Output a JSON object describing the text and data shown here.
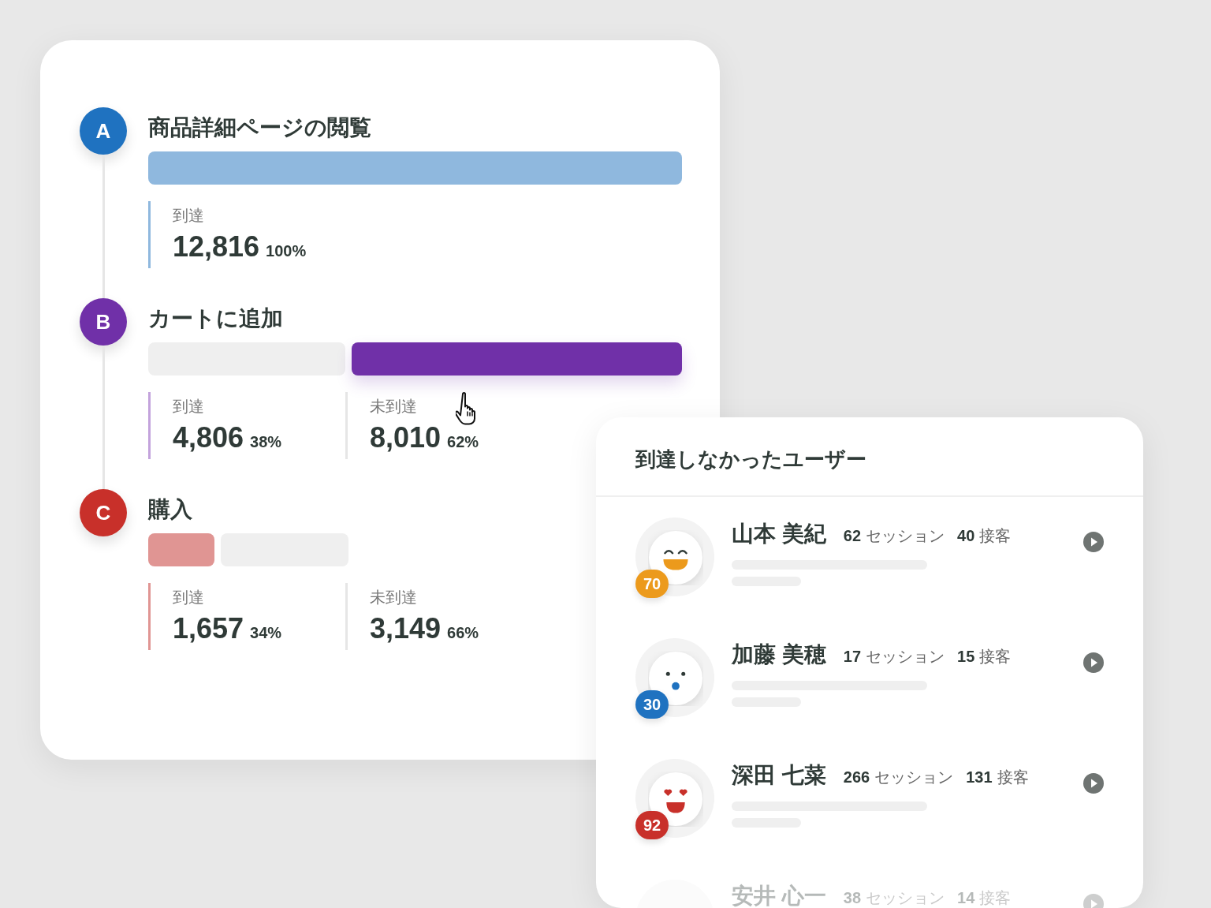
{
  "funnel": {
    "steps": [
      {
        "letter": "A",
        "color": "#1f72c0",
        "title": "商品詳細ページの閲覧",
        "segments": [
          {
            "color": "#8fb8de"
          }
        ],
        "stats": [
          {
            "label": "到達",
            "value": "12,816",
            "percent": "100%",
            "color": "#8fb8de"
          }
        ]
      },
      {
        "letter": "B",
        "color": "#7030a8",
        "title": "カートに追加",
        "segments": [
          {
            "color": "#efefef"
          },
          {
            "color": "#7030a8"
          }
        ],
        "stats": [
          {
            "label": "到達",
            "value": "4,806",
            "percent": "38%",
            "color": "#c3a3dc"
          },
          {
            "label": "未到達",
            "value": "8,010",
            "percent": "62%",
            "color": "#e6e6e6"
          }
        ]
      },
      {
        "letter": "C",
        "color": "#c8302a",
        "title": "購入",
        "segments": [
          {
            "color": "#e09593"
          },
          {
            "color": "#efefef"
          }
        ],
        "stats": [
          {
            "label": "到達",
            "value": "1,657",
            "percent": "34%",
            "color": "#e09593"
          },
          {
            "label": "未到達",
            "value": "3,149",
            "percent": "66%",
            "color": "#e6e6e6"
          }
        ]
      }
    ]
  },
  "users_panel": {
    "title": "到達しなかったユーザー",
    "users": [
      {
        "name": "山本 美紀",
        "sessions": "62",
        "sessions_label": "セッション",
        "visits": "40",
        "visits_label": "接客",
        "score": "70",
        "color": "#ec9a1c",
        "kind": "laugh",
        "faded": false
      },
      {
        "name": "加藤 美穂",
        "sessions": "17",
        "sessions_label": "セッション",
        "visits": "15",
        "visits_label": "接客",
        "score": "30",
        "color": "#1f72c0",
        "kind": "surprised",
        "faded": false
      },
      {
        "name": "深田 七菜",
        "sessions": "266",
        "sessions_label": "セッション",
        "visits": "131",
        "visits_label": "接客",
        "score": "92",
        "color": "#c8302a",
        "kind": "love",
        "faded": false
      },
      {
        "name": "安井 心一",
        "sessions": "38",
        "sessions_label": "セッション",
        "visits": "14",
        "visits_label": "接客",
        "faded": true
      }
    ]
  }
}
